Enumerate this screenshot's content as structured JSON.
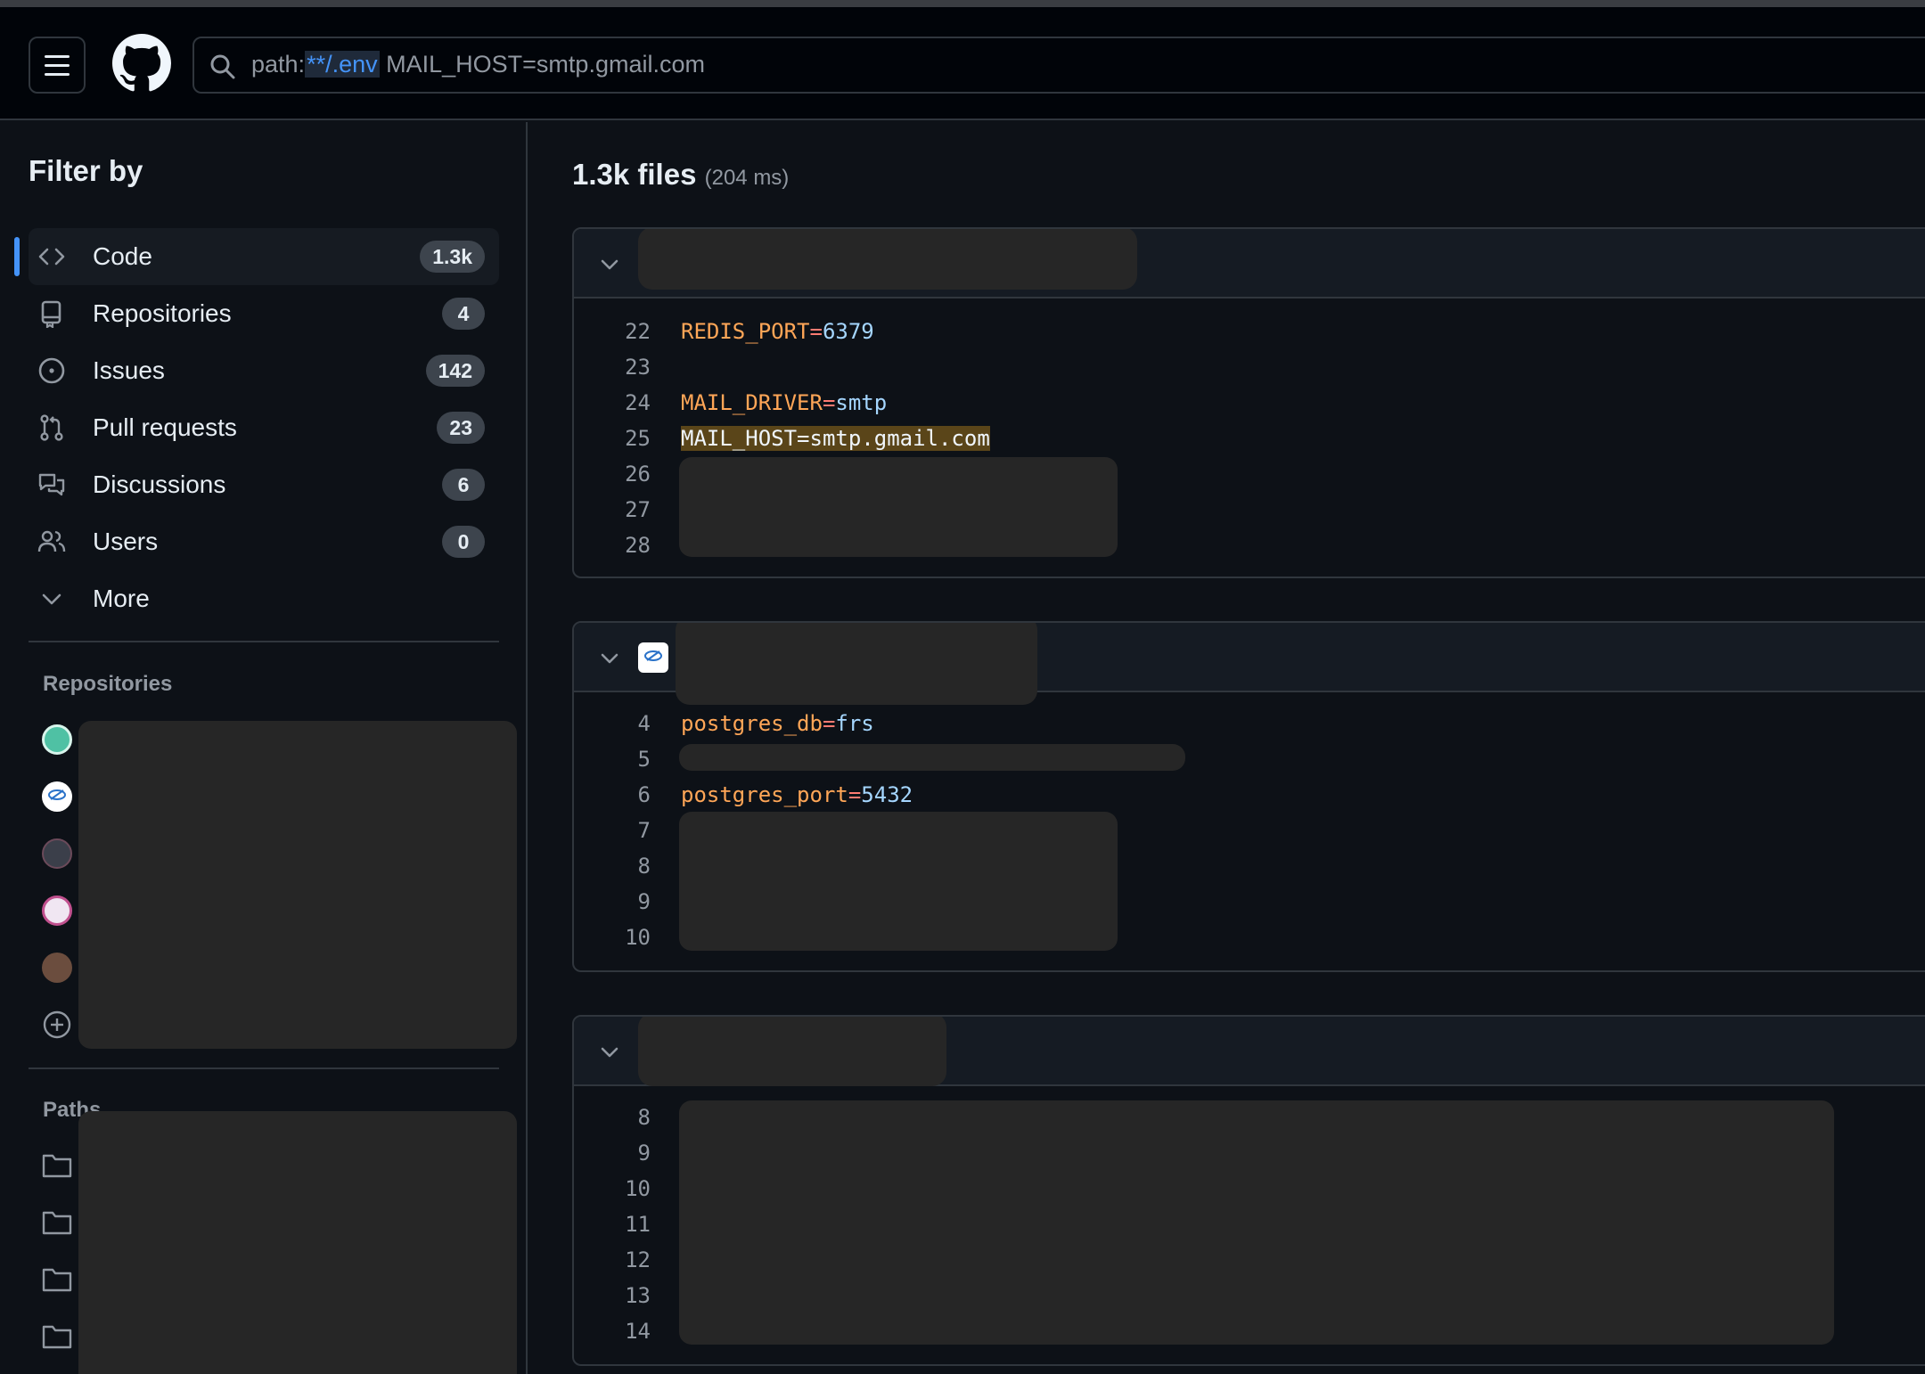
{
  "header": {
    "search_qualifier": "path:",
    "search_qualifier_value": "**/.env",
    "search_terms": " MAIL_HOST=smtp.gmail.com"
  },
  "sidebar": {
    "title": "Filter by",
    "items": [
      {
        "label": "Code",
        "count": "1.3k",
        "icon": "code-icon",
        "active": true
      },
      {
        "label": "Repositories",
        "count": "4",
        "icon": "repo-icon"
      },
      {
        "label": "Issues",
        "count": "142",
        "icon": "issue-icon"
      },
      {
        "label": "Pull requests",
        "count": "23",
        "icon": "pull-request-icon"
      },
      {
        "label": "Discussions",
        "count": "6",
        "icon": "discussion-icon"
      },
      {
        "label": "Users",
        "count": "0",
        "icon": "users-icon"
      },
      {
        "label": "More",
        "icon": "chevron-down-icon"
      }
    ],
    "repositories_title": "Repositories",
    "paths_title": "Paths"
  },
  "main": {
    "results_count": "1.3k files",
    "results_time": "(204 ms)",
    "results": [
      {
        "lines": [
          {
            "n": "22",
            "key": "REDIS_PORT",
            "eq": "=",
            "val": "6379"
          },
          {
            "n": "23"
          },
          {
            "n": "24",
            "key": "MAIL_DRIVER",
            "eq": "=",
            "val": "smtp"
          },
          {
            "n": "25",
            "highlight": "MAIL_HOST=smtp.gmail.com"
          },
          {
            "n": "26"
          },
          {
            "n": "27"
          },
          {
            "n": "28"
          }
        ]
      },
      {
        "lines": [
          {
            "n": "4",
            "key": "postgres_db",
            "eq": "=",
            "val": "frs"
          },
          {
            "n": "5"
          },
          {
            "n": "6",
            "key": "postgres_port",
            "eq": "=",
            "val": "5432"
          },
          {
            "n": "7"
          },
          {
            "n": "8"
          },
          {
            "n": "9"
          },
          {
            "n": "10"
          }
        ]
      },
      {
        "lines": [
          {
            "n": "8"
          },
          {
            "n": "9"
          },
          {
            "n": "10"
          },
          {
            "n": "11"
          },
          {
            "n": "12"
          },
          {
            "n": "13"
          },
          {
            "n": "14"
          }
        ]
      }
    ]
  },
  "colors": {
    "background": "#0d1117",
    "accent": "#4493f8",
    "key": "#ffa657",
    "operator": "#ff7b72",
    "value": "#a5d6ff",
    "match_highlight": "#5a4519"
  }
}
